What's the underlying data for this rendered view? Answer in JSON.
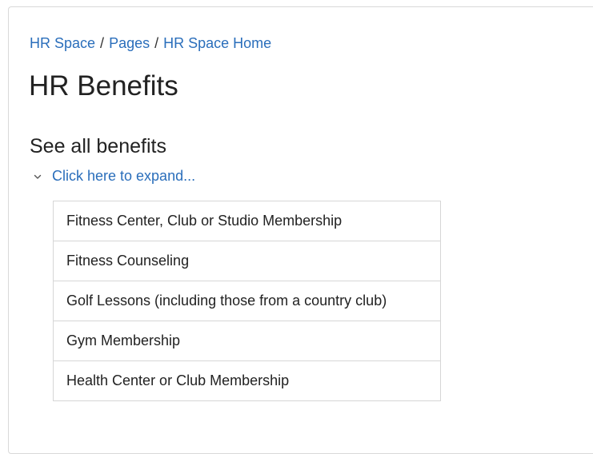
{
  "breadcrumb": {
    "items": [
      {
        "label": "HR Space"
      },
      {
        "label": "Pages"
      },
      {
        "label": "HR Space Home"
      }
    ],
    "separator": "/"
  },
  "page": {
    "title": "HR Benefits"
  },
  "section": {
    "heading": "See all benefits",
    "expand_label": "Click here to expand...",
    "expand_state": "expanded"
  },
  "benefits": [
    "Fitness Center, Club or Studio Membership",
    "Fitness Counseling",
    "Golf Lessons (including those from a country club)",
    "Gym Membership",
    "Health Center or Club Membership"
  ],
  "colors": {
    "link": "#2a6ebb",
    "text": "#222222",
    "border": "#d6d6d6"
  }
}
